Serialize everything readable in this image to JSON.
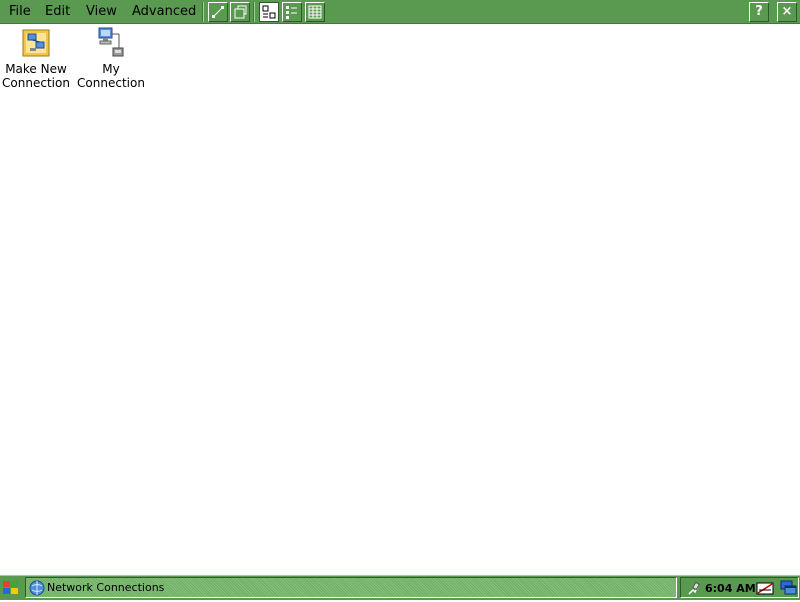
{
  "menu": {
    "file": "File",
    "edit": "Edit",
    "view": "View",
    "advanced": "Advanced"
  },
  "toolbar": {
    "buttons": [
      "connect-icon",
      "properties-icon",
      "large-icons-icon",
      "list-icon",
      "details-icon"
    ],
    "help": "?",
    "close": "×"
  },
  "desktop": {
    "icons": [
      {
        "label_line1": "Make New",
        "label_line2": "Connection",
        "icon": "make-new-connection-icon"
      },
      {
        "label_line1": "My",
        "label_line2": "Connection",
        "icon": "network-connection-icon"
      }
    ]
  },
  "taskbar": {
    "window_title": "Network Connections",
    "clock": "6:04 AM",
    "colors": {
      "bar": "#5a9a50",
      "desktop": "#ffffff"
    }
  }
}
